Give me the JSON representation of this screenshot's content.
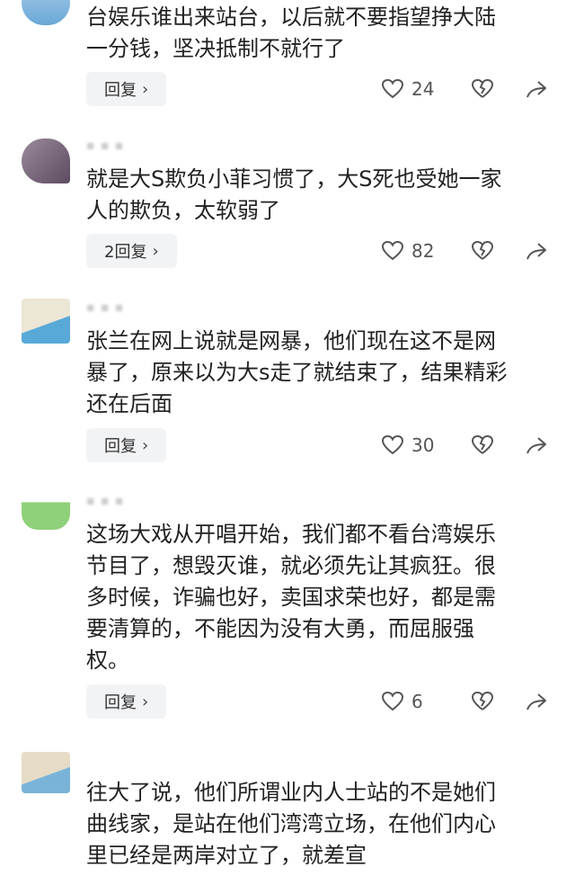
{
  "comments": [
    {
      "text": "台娱乐谁出来站台，以后就不要指望挣大陆\n一分钱，坚决抵制不就行了",
      "reply_label": "回复",
      "likes": "24",
      "avatar_colors": [
        "#a9cde9",
        "#6aa7d6"
      ]
    },
    {
      "meta": "▪ ▪ ▪",
      "text": "就是大S欺负小菲习惯了，大S死也受她一家\n人的欺负，太软弱了",
      "reply_label": "2回复",
      "likes": "82",
      "avatar_colors": [
        "#8b7a8c",
        "#5d4b61"
      ]
    },
    {
      "meta": "▪ ▪ ▪",
      "text": "张兰在网上说就是网暴，他们现在这不是网\n暴了，原来以为大s走了就结束了，结果精彩\n还在后面",
      "reply_label": "回复",
      "likes": "30",
      "avatar_colors": [
        "#e8e2d2",
        "#58a9d8"
      ]
    },
    {
      "meta": "▪ ▪ ▪",
      "text": "这场大戏从开唱开始，我们都不看台湾娱乐\n节目了，想毁灭谁，就必须先让其疯狂。很\n多时候，诈骗也好，卖国求荣也好，都是需\n要清算的，不能因为没有大勇，而屈服强\n权。",
      "reply_label": "回复",
      "likes": "6",
      "avatar_colors": [
        "#d8e8c8",
        "#7fc46a"
      ]
    },
    {
      "text": "往大了说，他们所谓业内人士站的不是她们\n曲线家，是站在他们湾湾立场，在他们内心\n里已经是两岸对立了，就差宣",
      "avatar_colors": [
        "#e4dcc8",
        "#7ab3d8"
      ]
    }
  ],
  "icons": {
    "reply_chevron": "chevron-right-icon",
    "like": "heart-icon",
    "dislike": "broken-heart-icon",
    "share": "share-arrow-icon"
  }
}
